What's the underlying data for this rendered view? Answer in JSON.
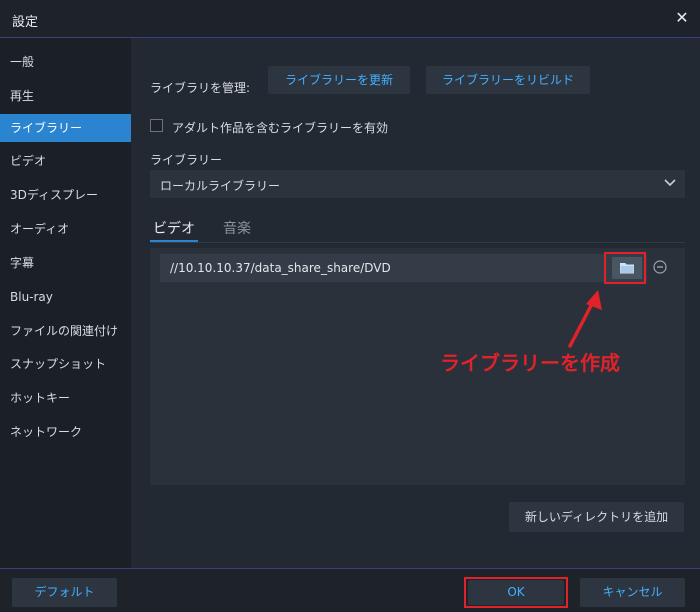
{
  "window": {
    "title": "設定",
    "close_glyph": "✕"
  },
  "sidebar": {
    "items": [
      {
        "label": "一般"
      },
      {
        "label": "再生"
      },
      {
        "label": "ライブラリー"
      },
      {
        "label": "ビデオ"
      },
      {
        "label": "3Dディスプレー"
      },
      {
        "label": "オーディオ"
      },
      {
        "label": "字幕"
      },
      {
        "label": "Blu-ray"
      },
      {
        "label": "ファイルの関連付け"
      },
      {
        "label": "スナップショット"
      },
      {
        "label": "ホットキー"
      },
      {
        "label": "ネットワーク"
      }
    ],
    "active_index": 2
  },
  "library": {
    "manage_label": "ライブラリを管理:",
    "update_button": "ライブラリーを更新",
    "rebuild_button": "ライブラリーをリビルド",
    "adult_checkbox_label": "アダルト作品を含むライブラリーを有効",
    "adult_checked": false,
    "library_label": "ライブラリー",
    "library_select_value": "ローカルライブラリー",
    "tabs": [
      {
        "label": "ビデオ"
      },
      {
        "label": "音楽"
      }
    ],
    "active_tab": 0,
    "paths": [
      "//10.10.10.37/data_share_share/DVD"
    ],
    "add_directory_button": "新しいディレクトリを追加"
  },
  "annotation": {
    "text": "ライブラリーを作成",
    "color": "#e0232a"
  },
  "footer": {
    "default_button": "デフォルト",
    "ok_button": "OK",
    "cancel_button": "キャンセル"
  },
  "colors": {
    "accent": "#2b84d0",
    "link_text": "#44b0ff",
    "highlight": "#e0232a"
  }
}
